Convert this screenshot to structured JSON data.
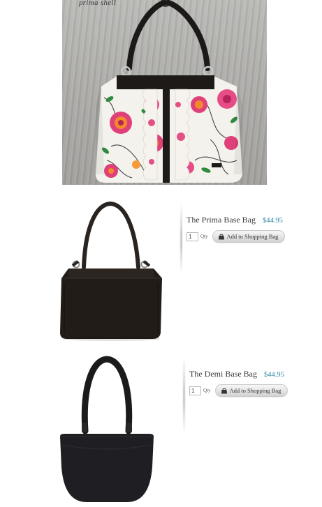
{
  "hero": {
    "caption": "prima shell",
    "image_alt": "Floral print shell on base bag"
  },
  "products": [
    {
      "name": "The Prima Base Bag",
      "price": "$44.95",
      "qty_value": "1",
      "qty_label": "Qty",
      "add_label": "Add to Shopping Bag"
    },
    {
      "name": "The Demi Base Bag",
      "price": "$44.95",
      "qty_value": "1",
      "qty_label": "Qty",
      "add_label": "Add to Shopping Bag"
    }
  ],
  "colors": {
    "price": "#2f8aa6",
    "bag_black": "#1e1a17",
    "rose_pink": "#e0407a",
    "rose_orange": "#f08a2a",
    "leaf_green": "#2f8a3e"
  }
}
